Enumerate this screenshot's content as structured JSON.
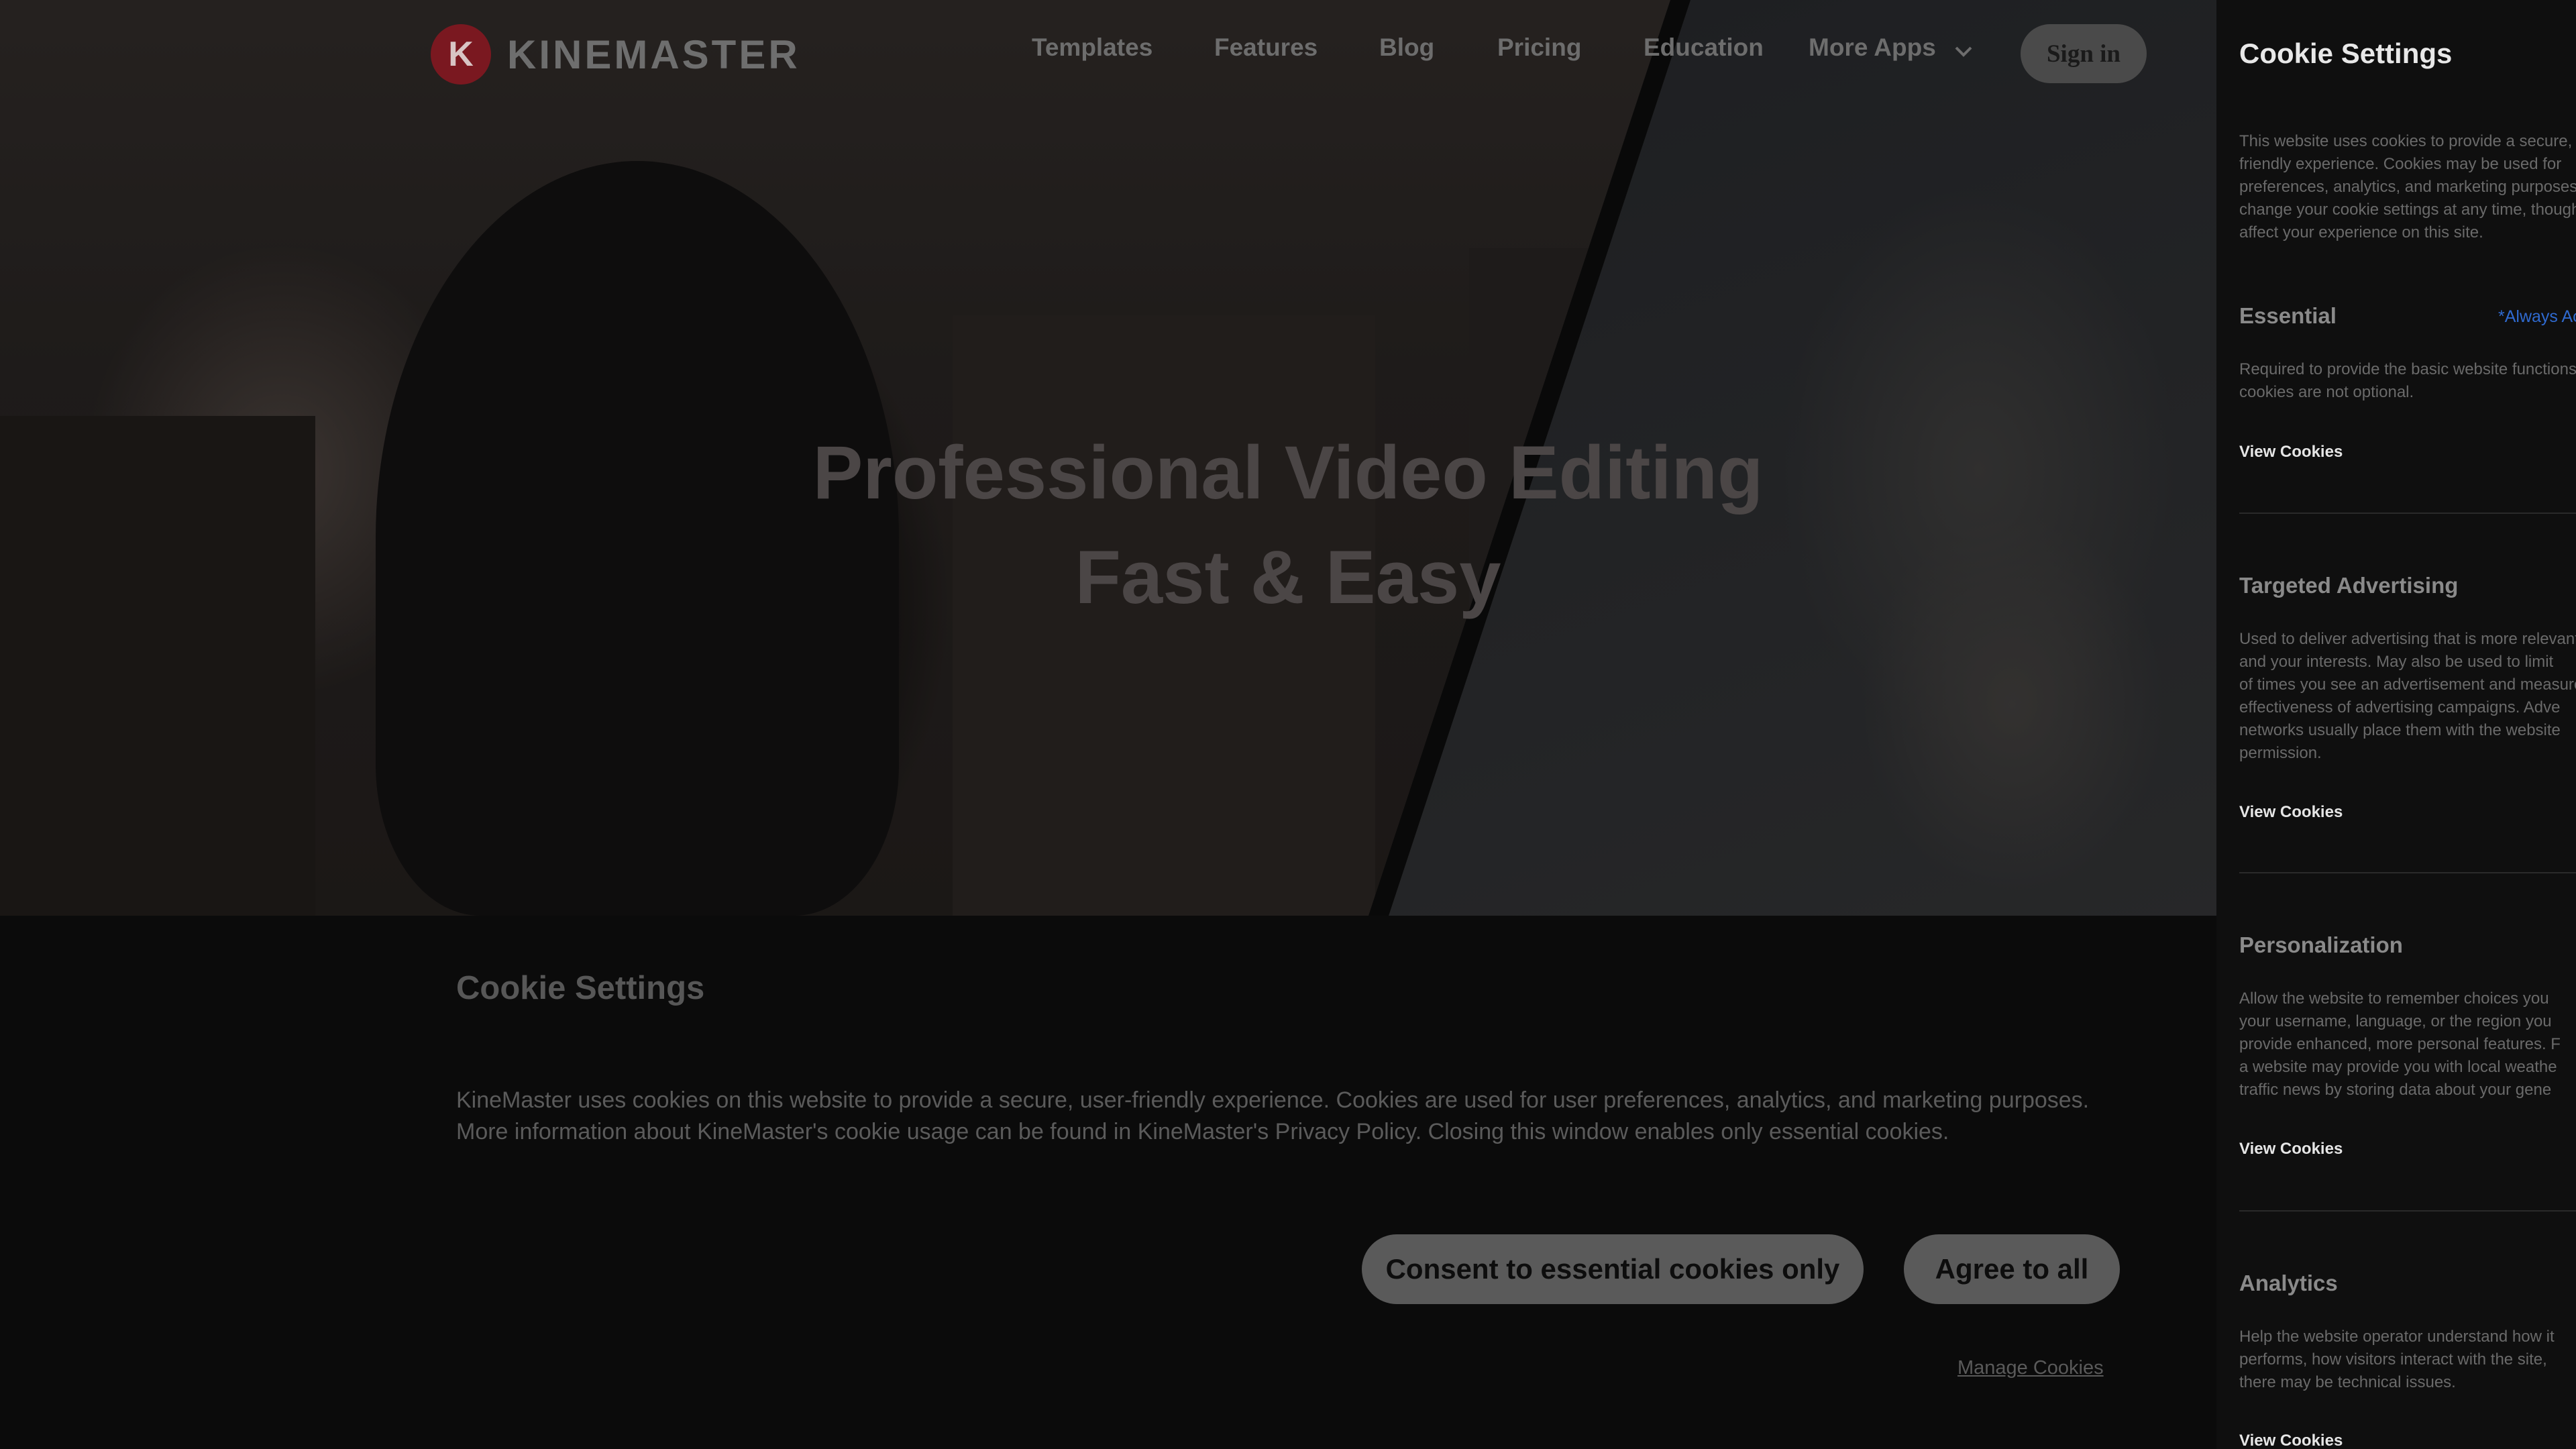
{
  "nav": {
    "logo_mark": "K",
    "logo_text": "KINEMASTER",
    "links": [
      "Templates",
      "Features",
      "Blog",
      "Pricing",
      "Education",
      "More Apps"
    ],
    "sign_in": "Sign in"
  },
  "hero": {
    "line1": "Professional Video Editing",
    "line2": "Fast & Easy"
  },
  "banner": {
    "title": "Cookie Settings",
    "text_line1": "KineMaster uses cookies on this website to provide a secure, user-friendly experience. Cookies are used for user preferences, analytics, and marketing purposes.",
    "text_line2": "More information about KineMaster's cookie usage can be found in KineMaster's Privacy Policy. Closing this window enables only essential cookies.",
    "btn_essential": "Consent to essential cookies only",
    "btn_agree": "Agree to all",
    "manage": "Manage Cookies"
  },
  "panel": {
    "title": "Cookie Settings",
    "intro": [
      "This website uses cookies to provide a secure,",
      "friendly experience. Cookies may be used for",
      "preferences, analytics, and marketing purposes.",
      "change your cookie settings at any time, though",
      "affect your experience on this site."
    ],
    "always": "*Always Active",
    "view": "View Cookies",
    "sections": [
      {
        "title": "Essential",
        "lines": [
          "Required to provide the basic website functions.",
          "cookies are not optional."
        ]
      },
      {
        "title": "Targeted Advertising",
        "lines": [
          "Used to deliver advertising that is more relevant",
          "and your interests. May also be used to limit",
          "of times you see an advertisement and measure",
          "effectiveness of advertising campaigns. Adve",
          "networks usually place them with the website",
          "permission."
        ]
      },
      {
        "title": "Personalization",
        "lines": [
          "Allow the website to remember choices you",
          "your username, language, or the region you",
          "provide enhanced, more personal features. F",
          "a website may provide you with local weathe",
          "traffic news by storing data about your gene"
        ]
      },
      {
        "title": "Analytics",
        "lines": [
          "Help the website operator understand how it",
          "performs, how visitors interact with the site,",
          "there may be technical issues."
        ]
      }
    ]
  }
}
